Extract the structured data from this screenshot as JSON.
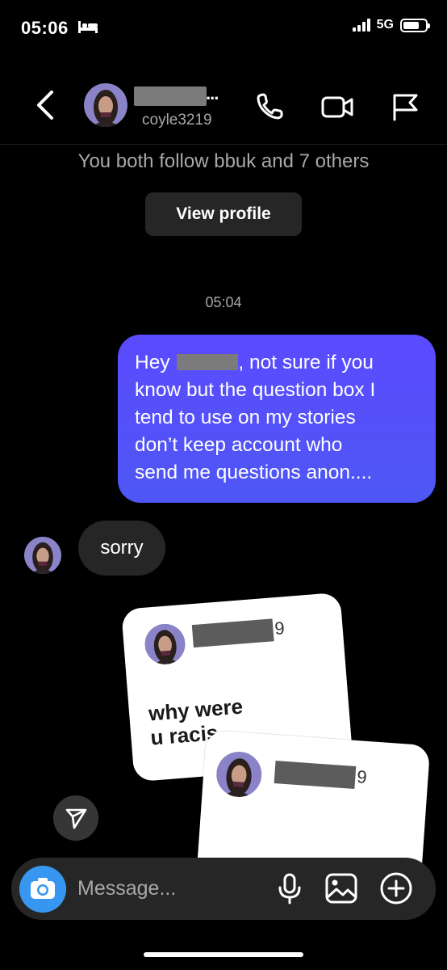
{
  "status_bar": {
    "time": "05:06",
    "network": "5G"
  },
  "header": {
    "name_suffix": "...",
    "username": "coyle3219"
  },
  "intro": {
    "follow_text": "You both follow bbuk and 7 others",
    "view_profile_label": "View profile"
  },
  "conversation": {
    "timestamp": "05:04",
    "outgoing": {
      "greeting": "Hey ",
      "line1_rest": ", not sure if you",
      "line2": "know but the question box I",
      "line3": "tend to use on my stories",
      "line4": "don’t keep account who",
      "line5": "send me questions anon...."
    },
    "incoming": {
      "text": "sorry"
    }
  },
  "story_cards": [
    {
      "username_tail": "9",
      "question_line1": "why were",
      "question_line2": "u racis"
    },
    {
      "username_tail": "9"
    }
  ],
  "composer": {
    "placeholder": "Message..."
  },
  "colors": {
    "background": "#000000",
    "outgoing_bubble": "#5b4bff",
    "incoming_bubble": "#262626",
    "camera_button": "#3797f0",
    "secondary_text": "#a8a8a8"
  }
}
